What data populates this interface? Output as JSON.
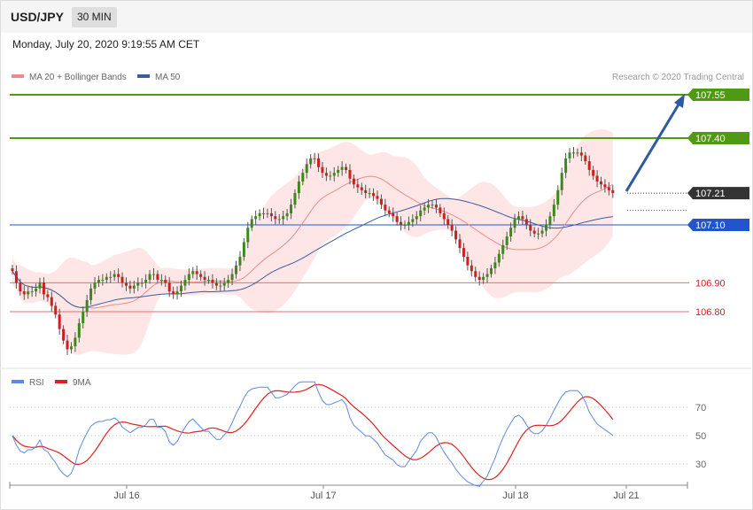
{
  "header": {
    "pair": "USD/JPY",
    "timeframe": "30 MIN",
    "datetime": "Monday, July 20, 2020 9:19:55 AM CET"
  },
  "colors": {
    "bull": "#3a8a1a",
    "bear": "#cc1f1f",
    "band_fill": "#ffdede",
    "ma20": "#f08a8a",
    "ma50": "#3b5e9a",
    "resistance": "#4f9a12",
    "pivot": "#2255cc",
    "support": "#e07070",
    "current": "#333333",
    "rsi": "#5b8ae0",
    "rsi_ma": "#e02020",
    "arrow": "#2e5aa0"
  },
  "chart_data": [
    {
      "type": "candlestick",
      "legend": [
        {
          "name": "MA 20 + Bollinger Bands",
          "color": "#f08a8a"
        },
        {
          "name": "MA 50",
          "color": "#3b5e9a"
        }
      ],
      "credit": "Research © 2020 Trading Central",
      "x_ticks": [
        "Jul 16",
        "Jul 17",
        "Jul 18",
        "Jul 21"
      ],
      "y_range": [
        106.6,
        107.6
      ],
      "levels": [
        {
          "value": 107.55,
          "label": "107.55",
          "kind": "resistance"
        },
        {
          "value": 107.4,
          "label": "107.40",
          "kind": "resistance"
        },
        {
          "value": 107.21,
          "label": "107.21",
          "kind": "current"
        },
        {
          "value": 107.1,
          "label": "107.10",
          "kind": "pivot"
        },
        {
          "value": 106.9,
          "label": "106.90",
          "kind": "support"
        },
        {
          "value": 106.8,
          "label": "106.80",
          "kind": "support"
        }
      ],
      "close": [
        106.94,
        106.9,
        106.87,
        106.86,
        106.87,
        106.87,
        106.88,
        106.9,
        106.86,
        106.85,
        106.82,
        106.79,
        106.74,
        106.7,
        106.67,
        106.68,
        106.71,
        106.76,
        106.8,
        106.84,
        106.88,
        106.9,
        106.91,
        106.91,
        106.92,
        106.92,
        106.93,
        106.92,
        106.9,
        106.89,
        106.88,
        106.89,
        106.9,
        106.9,
        106.91,
        106.93,
        106.93,
        106.91,
        106.91,
        106.9,
        106.87,
        106.86,
        106.87,
        106.89,
        106.91,
        106.93,
        106.94,
        106.93,
        106.92,
        106.91,
        106.91,
        106.9,
        106.89,
        106.89,
        106.9,
        106.91,
        106.93,
        106.96,
        106.99,
        107.04,
        107.09,
        107.12,
        107.13,
        107.14,
        107.14,
        107.14,
        107.13,
        107.12,
        107.12,
        107.13,
        107.14,
        107.17,
        107.21,
        107.25,
        107.28,
        107.31,
        107.33,
        107.33,
        107.3,
        107.28,
        107.27,
        107.27,
        107.28,
        107.29,
        107.3,
        107.29,
        107.26,
        107.24,
        107.23,
        107.22,
        107.21,
        107.21,
        107.2,
        107.19,
        107.17,
        107.15,
        107.14,
        107.13,
        107.11,
        107.1,
        107.1,
        107.11,
        107.12,
        107.13,
        107.15,
        107.16,
        107.17,
        107.17,
        107.16,
        107.14,
        107.12,
        107.1,
        107.08,
        107.05,
        107.02,
        106.99,
        106.96,
        106.94,
        106.92,
        106.91,
        106.92,
        106.93,
        106.95,
        106.97,
        107.0,
        107.03,
        107.06,
        107.09,
        107.12,
        107.13,
        107.12,
        107.1,
        107.08,
        107.07,
        107.07,
        107.08,
        107.1,
        107.13,
        107.17,
        107.22,
        107.28,
        107.33,
        107.35,
        107.35,
        107.35,
        107.34,
        107.32,
        107.29,
        107.27,
        107.25,
        107.24,
        107.23,
        107.22,
        107.21
      ],
      "rsi": {
        "legend": [
          {
            "name": "RSI",
            "color": "#5b8ae0"
          },
          {
            "name": "9MA",
            "color": "#e02020"
          }
        ],
        "levels": [
          70,
          50,
          30
        ],
        "y_range": [
          10,
          90
        ]
      }
    }
  ]
}
